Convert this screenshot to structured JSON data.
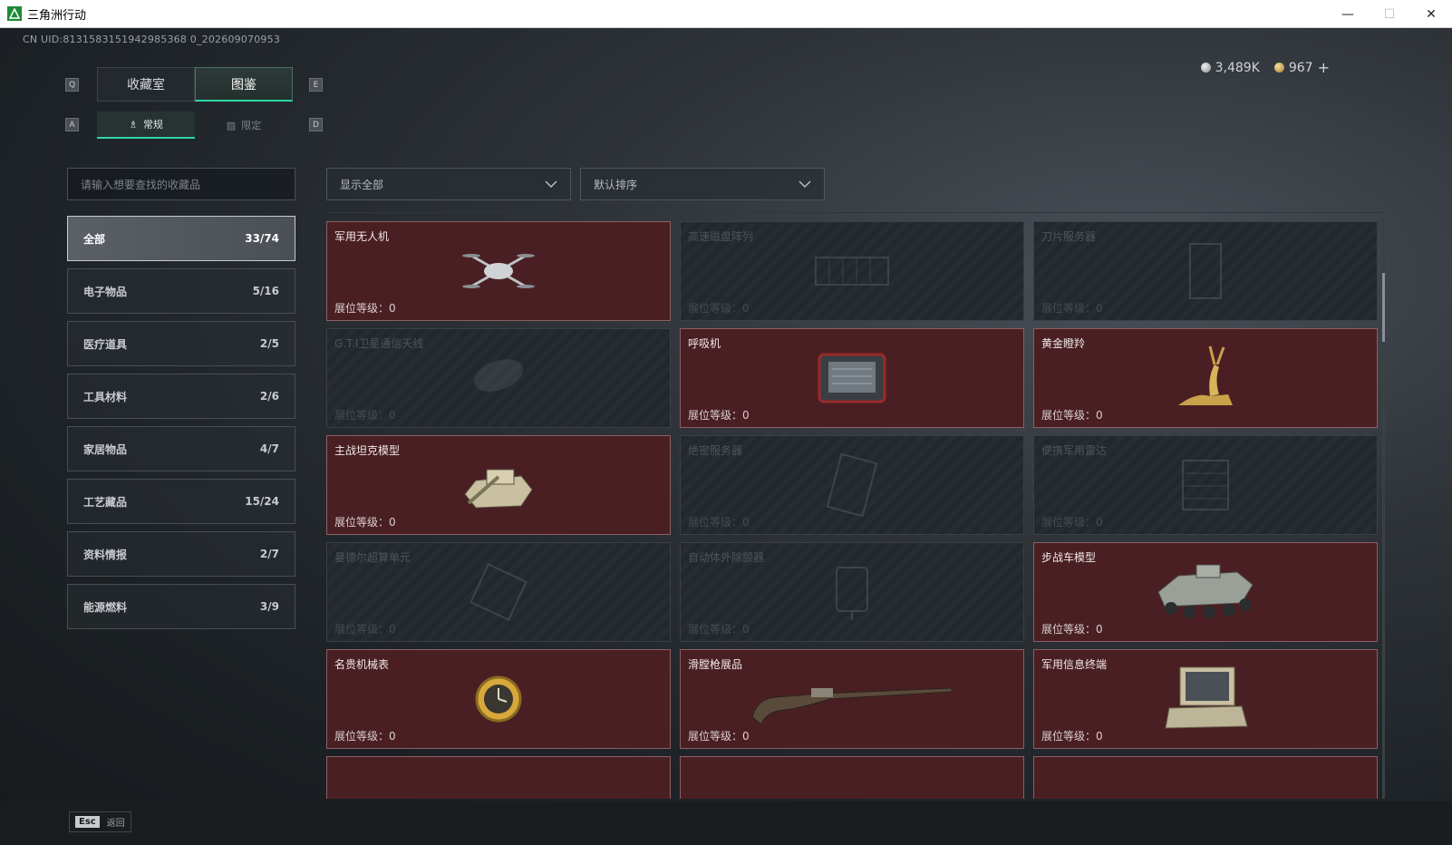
{
  "window": {
    "title": "三角洲行动",
    "minimize": "—",
    "maximize": "☐",
    "close": "✕"
  },
  "uid": "CN UID:8131583151942985368 0_202609070953",
  "currency": {
    "silver": "3,489K",
    "gold": "967",
    "plus": "+"
  },
  "keys": {
    "q": "Q",
    "e": "E",
    "a": "A",
    "d": "D"
  },
  "main_tabs": [
    {
      "label": "收藏室"
    },
    {
      "label": "图鉴"
    }
  ],
  "sub_tabs": [
    {
      "label": "常规"
    },
    {
      "label": "限定"
    }
  ],
  "search": {
    "placeholder": "请输入想要查找的收藏品"
  },
  "filters": {
    "show": "显示全部",
    "sort": "默认排序"
  },
  "categories": [
    {
      "label": "全部",
      "count": "33/74"
    },
    {
      "label": "电子物品",
      "count": "5/16"
    },
    {
      "label": "医疗道具",
      "count": "2/5"
    },
    {
      "label": "工具材料",
      "count": "2/6"
    },
    {
      "label": "家居物品",
      "count": "4/7"
    },
    {
      "label": "工艺藏品",
      "count": "15/24"
    },
    {
      "label": "资料情报",
      "count": "2/7"
    },
    {
      "label": "能源燃料",
      "count": "3/9"
    }
  ],
  "level_label": "展位等级：",
  "items": [
    {
      "name": "军用无人机",
      "level": "0",
      "owned": true,
      "icon": "drone-icon"
    },
    {
      "name": "高速磁盘阵列",
      "level": "0",
      "owned": false,
      "icon": "disk-array-icon"
    },
    {
      "name": "刀片服务器",
      "level": "0",
      "owned": false,
      "icon": "blade-server-icon"
    },
    {
      "name": "G.T.I卫星通信天线",
      "level": "0",
      "owned": false,
      "icon": "satellite-dish-icon"
    },
    {
      "name": "呼吸机",
      "level": "0",
      "owned": true,
      "icon": "ventilator-icon"
    },
    {
      "name": "黄金瞪羚",
      "level": "0",
      "owned": true,
      "icon": "golden-gazelle-icon"
    },
    {
      "name": "主战坦克模型",
      "level": "0",
      "owned": true,
      "icon": "tank-icon"
    },
    {
      "name": "绝密服务器",
      "level": "0",
      "owned": false,
      "icon": "secret-server-icon"
    },
    {
      "name": "便携军用雷达",
      "level": "0",
      "owned": false,
      "icon": "radar-icon"
    },
    {
      "name": "曼德尔超算单元",
      "level": "0",
      "owned": false,
      "icon": "supercomputer-icon"
    },
    {
      "name": "自动体外除颤器",
      "level": "0",
      "owned": false,
      "icon": "defibrillator-icon"
    },
    {
      "name": "步战车模型",
      "level": "0",
      "owned": true,
      "icon": "ifv-icon"
    },
    {
      "name": "名贵机械表",
      "level": "0",
      "owned": true,
      "icon": "watch-icon"
    },
    {
      "name": "滑膛枪展品",
      "level": "0",
      "owned": true,
      "icon": "musket-icon"
    },
    {
      "name": "军用信息终端",
      "level": "0",
      "owned": true,
      "icon": "terminal-icon"
    }
  ],
  "bottom": {
    "esc_key": "Esc",
    "back_label": "返回"
  },
  "colors": {
    "accent": "#2fd6a8",
    "owned_card": "#4a1f23",
    "missing_card": "#23282c"
  }
}
